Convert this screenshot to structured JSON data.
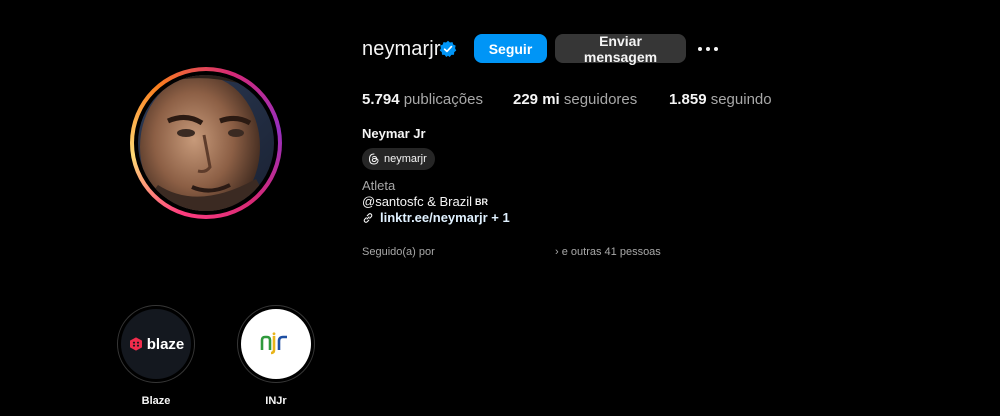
{
  "profile": {
    "username": "neymarjr",
    "verified": true,
    "follow_label": "Seguir",
    "message_label": "Enviar mensagem",
    "more_icon": "more-horizontal-icon"
  },
  "stats": {
    "posts_count": "5.794",
    "posts_label": "publicações",
    "followers_count": "229 mi",
    "followers_label": "seguidores",
    "following_count": "1.859",
    "following_label": "seguindo"
  },
  "bio": {
    "full_name": "Neymar Jr",
    "threads_handle": "neymarjr",
    "category": "Atleta",
    "line1": "@santosfc & Brazil",
    "line1_flag": "BR",
    "link": "linktr.ee/neymarjr + 1",
    "followed_by_prefix": "Seguido(a) por",
    "followed_by_suffix": "e outras 41 pessoas"
  },
  "highlights": [
    {
      "label": "Blaze",
      "logo_text": "blaze"
    },
    {
      "label": "INJr",
      "logo_text": "njr"
    }
  ],
  "colors": {
    "background": "#000000",
    "accent": "#0095f6",
    "secondary_button": "#363636",
    "muted_text": "#a8a8a8",
    "verified_badge": "#0095f6"
  }
}
